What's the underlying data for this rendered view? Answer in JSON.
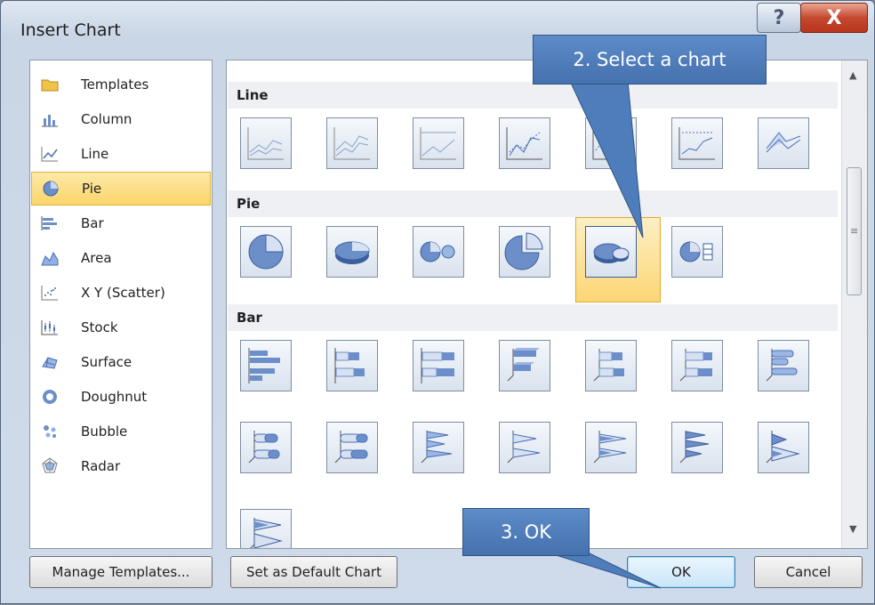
{
  "window": {
    "title": "Insert Chart",
    "help_label": "?",
    "close_label": "X"
  },
  "categories": [
    {
      "label": "Templates",
      "icon": "folder-icon"
    },
    {
      "label": "Column",
      "icon": "column-chart-icon"
    },
    {
      "label": "Line",
      "icon": "line-chart-icon"
    },
    {
      "label": "Pie",
      "icon": "pie-chart-icon",
      "selected": true
    },
    {
      "label": "Bar",
      "icon": "bar-chart-icon"
    },
    {
      "label": "Area",
      "icon": "area-chart-icon"
    },
    {
      "label": "X Y (Scatter)",
      "icon": "scatter-chart-icon"
    },
    {
      "label": "Stock",
      "icon": "stock-chart-icon"
    },
    {
      "label": "Surface",
      "icon": "surface-chart-icon"
    },
    {
      "label": "Doughnut",
      "icon": "doughnut-chart-icon"
    },
    {
      "label": "Bubble",
      "icon": "bubble-chart-icon"
    },
    {
      "label": "Radar",
      "icon": "radar-chart-icon"
    }
  ],
  "sections": {
    "line": "Line",
    "pie": "Pie",
    "bar": "Bar"
  },
  "buttons": {
    "manage_templates": "Manage Templates...",
    "set_default": "Set as Default Chart",
    "ok": "OK",
    "cancel": "Cancel"
  },
  "callouts": {
    "select_chart": "2. Select a chart",
    "ok": "3. OK"
  },
  "colors": {
    "selection": "#fbd56a",
    "callout": "#4f7dbb",
    "chart_fill": "#6d8fc9"
  }
}
